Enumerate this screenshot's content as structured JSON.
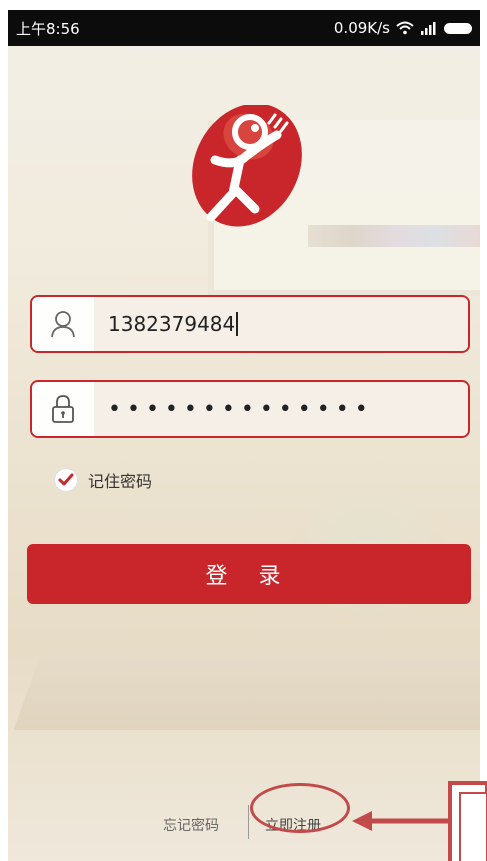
{
  "status": {
    "time": "上午8:56",
    "speed": "0.09K/s"
  },
  "login": {
    "username_value": "1382379484",
    "password_mask": "••••••••••••••",
    "remember_label": "记住密码",
    "remember_checked": true,
    "login_button": "登 录"
  },
  "footer": {
    "forgot_label": "忘记密码",
    "register_label": "立即注册"
  },
  "colors": {
    "accent": "#c8262a",
    "annotation": "#c24a4a"
  }
}
